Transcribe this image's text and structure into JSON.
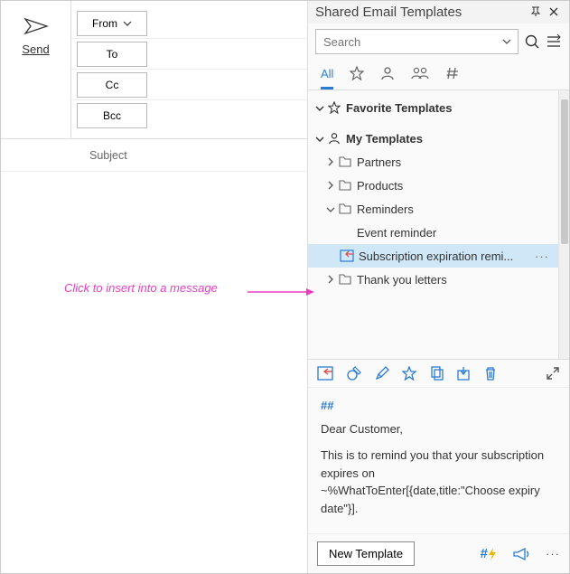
{
  "compose": {
    "send_label": "Send",
    "from_label": "From",
    "to_label": "To",
    "cc_label": "Cc",
    "bcc_label": "Bcc",
    "subject_label": "Subject"
  },
  "guide_text": "Click to insert into a message",
  "panel": {
    "title": "Shared Email Templates",
    "search_placeholder": "Search",
    "tabs": {
      "all_label": "All"
    },
    "tree": {
      "favorites_label": "Favorite Templates",
      "my_templates_label": "My Templates",
      "folders": {
        "partners": "Partners",
        "products": "Products",
        "reminders": "Reminders",
        "thank_you": "Thank you letters"
      },
      "items": {
        "event_reminder": "Event reminder",
        "sub_expiration": "Subscription expiration remi..."
      }
    },
    "preview": {
      "hashes": "##",
      "line1": "Dear Customer,",
      "line2": "This is to remind you that your subscription expires on ~%WhatToEnter[{date,title:\"Choose expiry date\"}]."
    },
    "footer": {
      "new_template_label": "New Template",
      "hash_label": "#"
    }
  }
}
